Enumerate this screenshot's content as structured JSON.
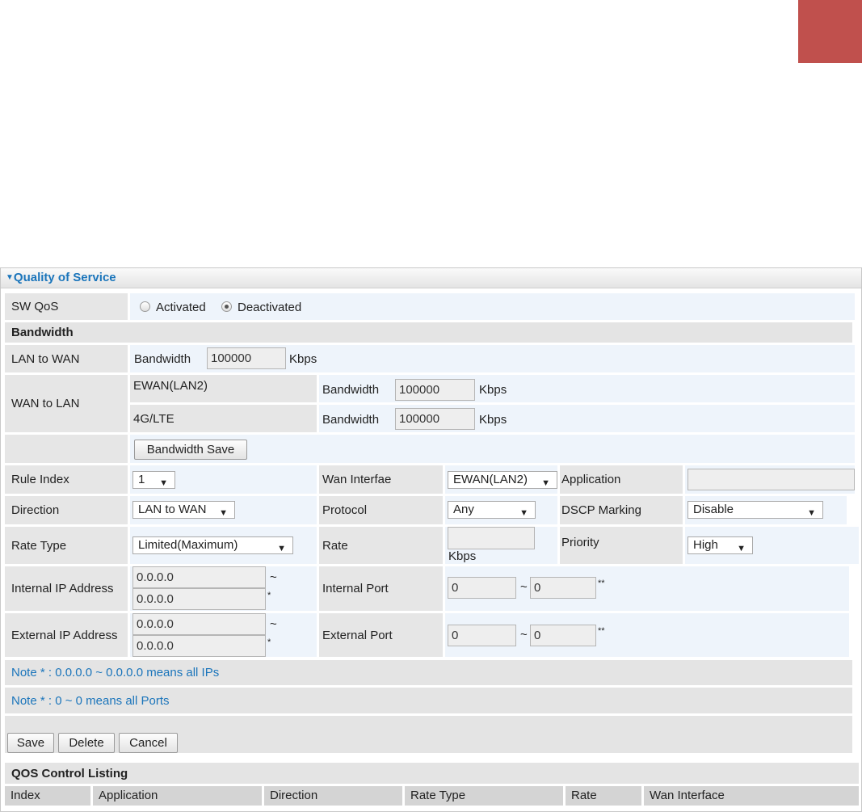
{
  "panel": {
    "title": "Quality of Service"
  },
  "sw_qos": {
    "label": "SW QoS",
    "opt_activated": "Activated",
    "opt_deactivated": "Deactivated",
    "selected": "Deactivated"
  },
  "bandwidth": {
    "section_label": "Bandwidth",
    "lan_to_wan_label": "LAN to WAN",
    "wan_to_lan_label": "WAN to LAN",
    "bw_label": "Bandwidth",
    "unit": "Kbps",
    "lan_to_wan_value": "100000",
    "ewan_name": "EWAN(LAN2)",
    "ewan_value": "100000",
    "lte_name": "4G/LTE",
    "lte_value": "100000",
    "save_label": "Bandwidth Save"
  },
  "rule": {
    "rule_index_label": "Rule Index",
    "rule_index_value": "1",
    "wan_interface_label": "Wan Interfae",
    "wan_interface_value": "EWAN(LAN2)",
    "application_label": "Application",
    "application_value": "",
    "direction_label": "Direction",
    "direction_value": "LAN to WAN",
    "protocol_label": "Protocol",
    "protocol_value": "Any",
    "dscp_label": "DSCP Marking",
    "dscp_value": "Disable",
    "rate_type_label": "Rate Type",
    "rate_type_value": "Limited(Maximum)",
    "rate_label": "Rate",
    "rate_value": "",
    "rate_unit": "Kbps",
    "priority_label": "Priority",
    "priority_value": "High",
    "internal_ip_label": "Internal IP Address",
    "internal_ip_start": "0.0.0.0",
    "internal_ip_end": "0.0.0.0",
    "internal_port_label": "Internal Port",
    "internal_port_start": "0",
    "internal_port_end": "0",
    "external_ip_label": "External IP Address",
    "external_ip_start": "0.0.0.0",
    "external_ip_end": "0.0.0.0",
    "external_port_label": "External Port",
    "external_port_start": "0",
    "external_port_end": "0",
    "tilde": "~",
    "star": "*",
    "double_star": "**"
  },
  "notes": {
    "ip_note": "Note * : 0.0.0.0 ~ 0.0.0.0 means all IPs",
    "port_note": "Note * : 0 ~ 0 means all Ports"
  },
  "actions": {
    "save": "Save",
    "delete": "Delete",
    "cancel": "Cancel"
  },
  "listing": {
    "title": "QOS Control Listing",
    "columns": [
      "Index",
      "Application",
      "Direction",
      "Rate Type",
      "Rate",
      "Wan Interface"
    ]
  },
  "colors": {
    "accent": "#1b75bb",
    "corner_block": "#c0504d"
  },
  "icons": {
    "collapse": "triangle-down-icon",
    "dropdown": "chevron-down-icon"
  }
}
